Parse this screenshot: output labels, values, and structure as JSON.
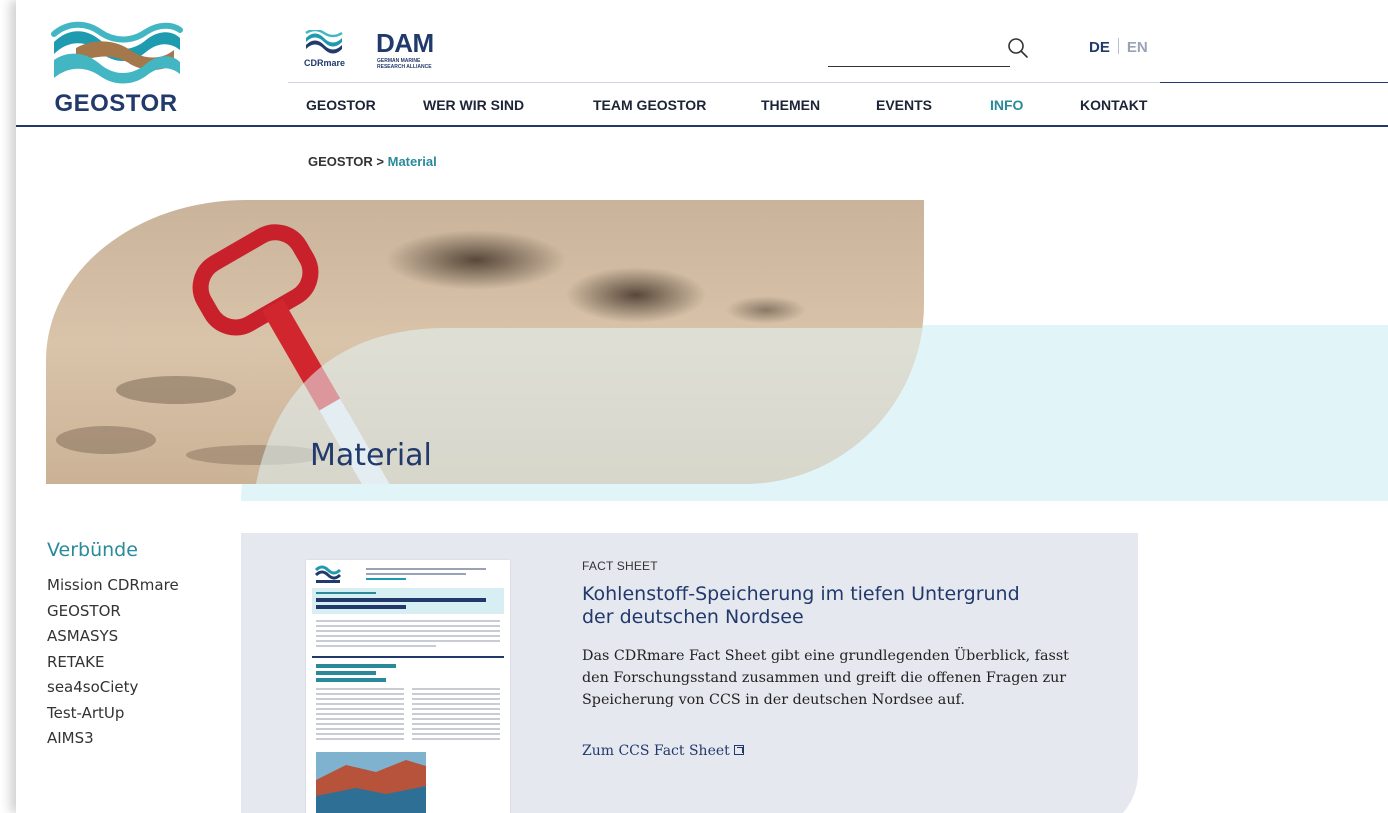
{
  "site": {
    "logo_text": "GEOSTOR"
  },
  "partners": {
    "cdrmare_label": "CDRmare",
    "dam_big": "DAM",
    "dam_sub_1": "GERMAN MARINE",
    "dam_sub_2": "RESEARCH ALLIANCE"
  },
  "search": {
    "placeholder": ""
  },
  "language": {
    "de": "DE",
    "en": "EN"
  },
  "nav": {
    "items": [
      {
        "label": "GEOSTOR"
      },
      {
        "label": "WER WIR SIND"
      },
      {
        "label": "TEAM GEOSTOR"
      },
      {
        "label": "THEMEN"
      },
      {
        "label": "EVENTS"
      },
      {
        "label": "INFO"
      },
      {
        "label": "KONTAKT"
      }
    ]
  },
  "breadcrumb": {
    "root": "GEOSTOR",
    "separator": " > ",
    "current": "Material"
  },
  "hero": {
    "title": "Material"
  },
  "sidebar": {
    "title": "Verbünde",
    "items": [
      {
        "label": "Mission CDRmare"
      },
      {
        "label": "GEOSTOR"
      },
      {
        "label": "ASMASYS"
      },
      {
        "label": "RETAKE"
      },
      {
        "label": "sea4soCiety"
      },
      {
        "label": "Test-ArtUp"
      },
      {
        "label": "AIMS3"
      }
    ]
  },
  "card": {
    "kicker": "FACT SHEET",
    "title": "Kohlenstoff-Speicherung im tiefen Untergrund der deutschen Nordsee",
    "text": "Das CDRmare Fact Sheet gibt eine grundlegenden Überblick, fasst den Forschungsstand zusammen und greift die offenen Fragen zur Speicherung von CCS in der deutschen Nordsee auf.",
    "link": "Zum CCS Fact Sheet"
  },
  "colors": {
    "navy": "#213a6b",
    "teal": "#2a8a99",
    "light_cyan": "#e1f4f7",
    "card_bg": "#e6e8ef"
  }
}
